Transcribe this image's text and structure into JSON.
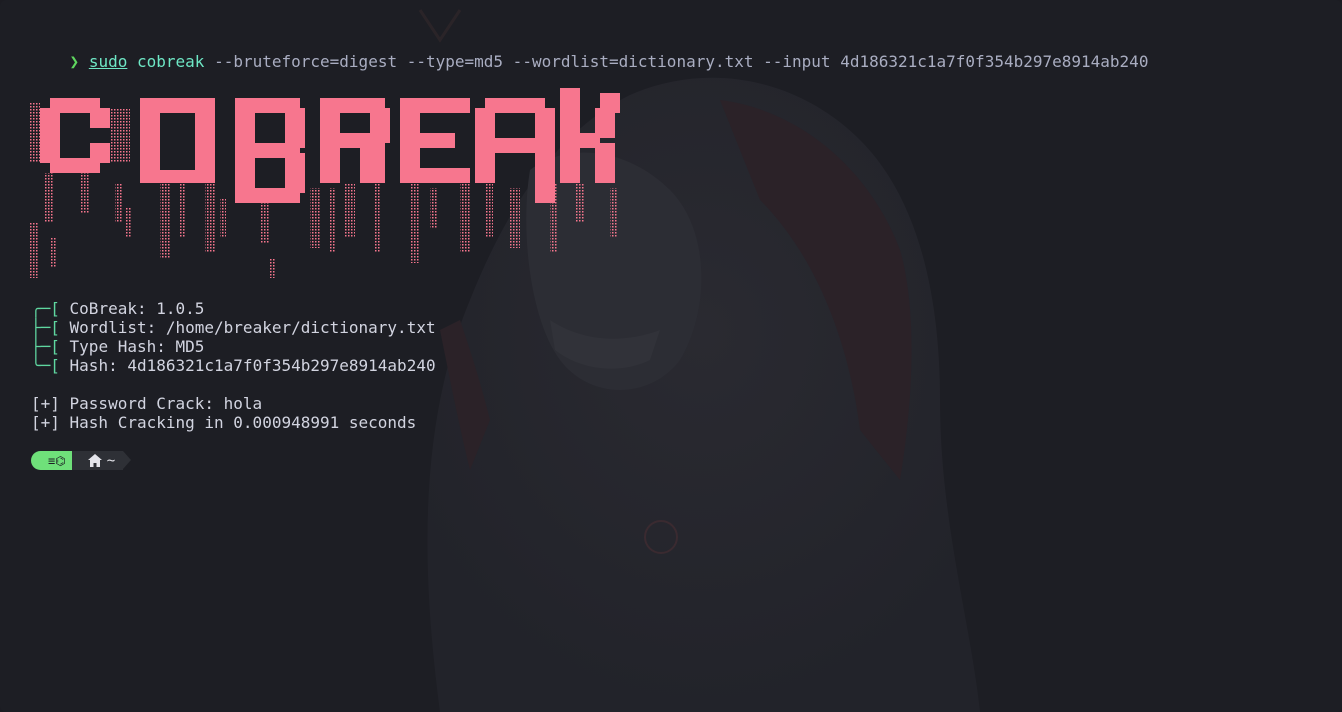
{
  "command": {
    "prompt_symbol": "❯",
    "sudo": "sudo",
    "program": "cobreak",
    "args": "--bruteforce=digest --type=md5 --wordlist=dictionary.txt --input 4d186321c1a7f0f354b297e8914ab240"
  },
  "banner": {
    "text": "COBREAK",
    "color": "#f7768e"
  },
  "info": {
    "tree_top": "╭─[",
    "tree_mid": "├─[",
    "tree_bottom": "╰─[",
    "version": " CoBreak: 1.0.5",
    "wordlist": " Wordlist: /home/breaker/dictionary.txt",
    "type_hash": " Type Hash: MD5",
    "hash": " Hash: 4d186321c1a7f0f354b297e8914ab240"
  },
  "result": {
    "password_line": "[+] Password Crack: hola",
    "time_line": "[+] Hash Cracking in 0.000948991 seconds"
  },
  "statusbar": {
    "os_icon": "≡⌬",
    "home_icon": "home-icon",
    "cwd": "~"
  },
  "colors": {
    "background": "#1d1e24",
    "accent_green": "#6fe07a",
    "tree_green": "#5fd7a0",
    "command_cyan": "#6ee7c5"
  }
}
